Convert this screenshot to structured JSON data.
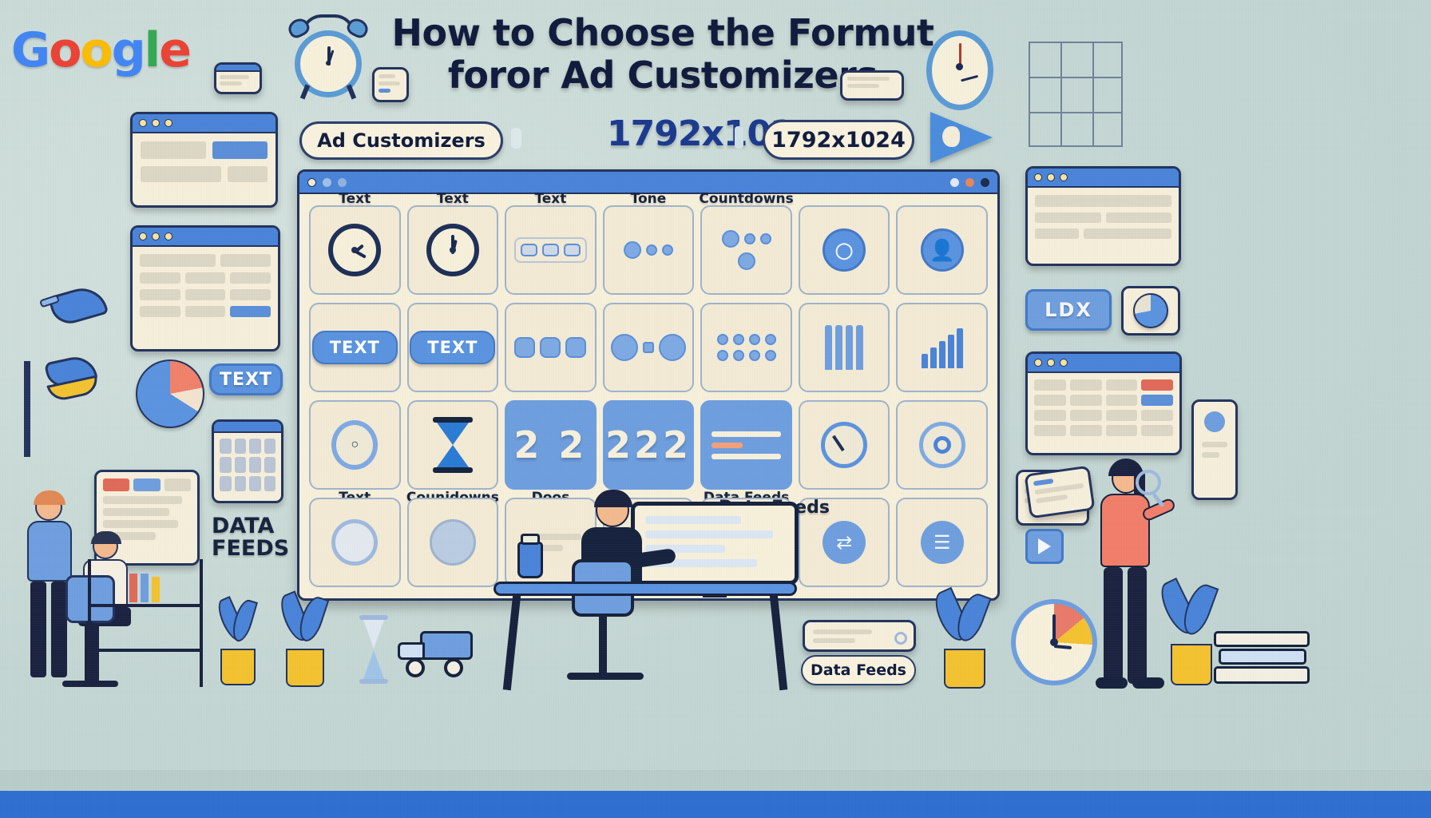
{
  "brand": {
    "logo_letters": [
      "G",
      "o",
      "o",
      "g",
      "l",
      "e"
    ],
    "logo_colors": [
      "#4285F4",
      "#EA4335",
      "#FBBC05",
      "#4285F4",
      "#34A853",
      "#EA4335"
    ]
  },
  "headline": {
    "line1": "How to Choose the Formut",
    "line2": "foror Ad Customizers"
  },
  "badges": {
    "ad_customizers": "Ad Customizers",
    "dimensions_big": "1792x1024",
    "dimensions_pill": "1792x1024"
  },
  "grid": {
    "row1_labels": [
      "Text",
      "Text",
      "Text",
      "Tone",
      "Countdowns",
      "",
      ""
    ],
    "row3_labels_below": [
      "Text",
      "Counidowns",
      "Doos",
      "",
      "Data Feeds",
      "",
      ""
    ],
    "data_feeds_label": "Data Feeds",
    "text_buttons": [
      "TEXT",
      "TEXT"
    ],
    "big_numbers": [
      "2 2",
      "222"
    ],
    "bar_chart_values": [
      18,
      26,
      34,
      42,
      50
    ]
  },
  "side": {
    "text_button": "TEXT",
    "data_feeds_stack_line1": "DATA",
    "data_feeds_stack_line2": "FEEDS",
    "ldx_tile": "LDX",
    "bottom_pill": "Data Feeds"
  },
  "colors": {
    "background": "#c4d6d3",
    "accent_blue": "#4a84d8",
    "deep_navy": "#23345e",
    "cream": "#f6efda",
    "orange": "#f2a07a",
    "yellow": "#f2c230",
    "bottom_strip": "#2f6fd0"
  }
}
